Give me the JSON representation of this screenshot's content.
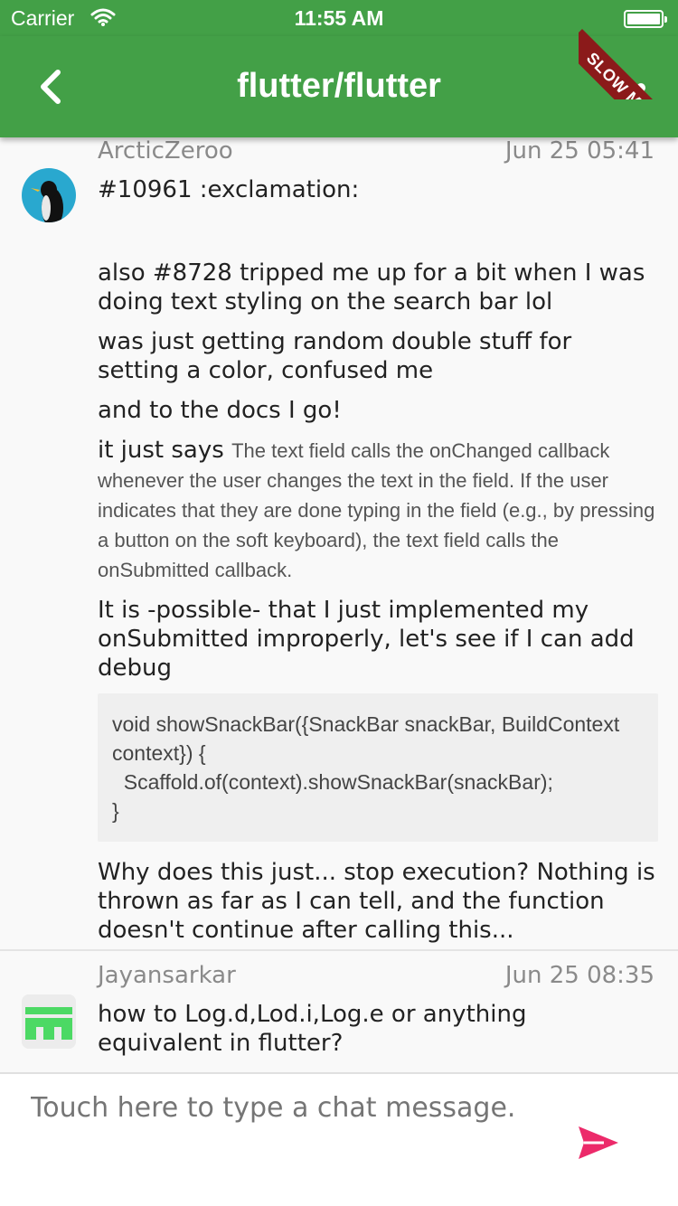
{
  "status_bar": {
    "carrier": "Carrier",
    "time": "11:55 AM"
  },
  "app_bar": {
    "title": "flutter/flutter",
    "back_icon": "chevron-left-icon",
    "more_icon": "more-horizontal-icon",
    "color": "#43a047"
  },
  "debug_banner": "SLOW MODE",
  "messages": [
    {
      "author": "ArcticZeroo",
      "date": "Jun 25 05:41",
      "paragraphs": [
        "#10961 :exclamation:",
        "also #8728 tripped me up for a bit when I was doing text styling on the search bar lol",
        "was just getting random double stuff for setting a color, confused me",
        "and to the docs I go!"
      ],
      "quote_lead": "it just says",
      "quote_text": "The text field calls the onChanged callback whenever the user changes the text in the field. If the user indicates that they are done typing in the field (e.g., by pressing a button on the soft keyboard), the text field calls the onSubmitted callback.",
      "paragraph_after_quote": "It is -possible- that I just implemented my onSubmitted improperly, let's see if I can add debug",
      "code": "void showSnackBar({SnackBar snackBar, BuildContext context}) {\n  Scaffold.of(context).showSnackBar(snackBar);\n}",
      "closing": "Why does this just... stop execution? Nothing is thrown as far as I can tell, and the function doesn't continue after calling this..."
    },
    {
      "author": "Jayansarkar",
      "date": "Jun 25 08:35",
      "text": "how to Log.d,Lod.i,Log.e or anything equivalent in flutter?"
    }
  ],
  "composer": {
    "placeholder": "Touch here to type a chat message.",
    "send_icon": "send-icon",
    "send_color": "#ec2a6a"
  }
}
